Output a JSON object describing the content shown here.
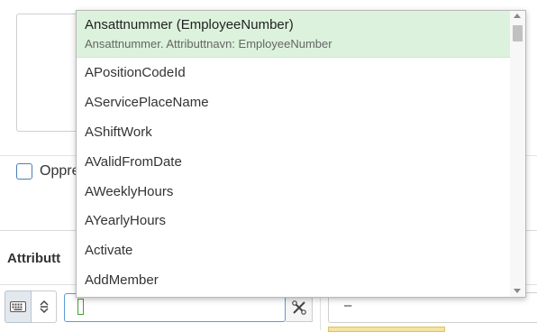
{
  "form": {
    "checkbox_label": "Oppre",
    "attribute_label": "Attributt",
    "right_value": "–"
  },
  "dropdown": {
    "selected": {
      "title": "Ansattnummer (EmployeeNumber)",
      "subtitle": "Ansattnummer. Attributtnavn: EmployeeNumber"
    },
    "items": [
      "APositionCodeId",
      "AServicePlaceName",
      "AShiftWork",
      "AValidFromDate",
      "AWeeklyHours",
      "AYearlyHours",
      "Activate",
      "AddMember"
    ]
  },
  "icons": {
    "keyboard": "keyboard-icon",
    "sort": "sort-updown-icon",
    "clear": "clear-filter-icon"
  },
  "colors": {
    "selected_bg": "#dcf2dc",
    "input_border": "#5b9bd5",
    "accent_yellow": "#f6e3a0"
  }
}
